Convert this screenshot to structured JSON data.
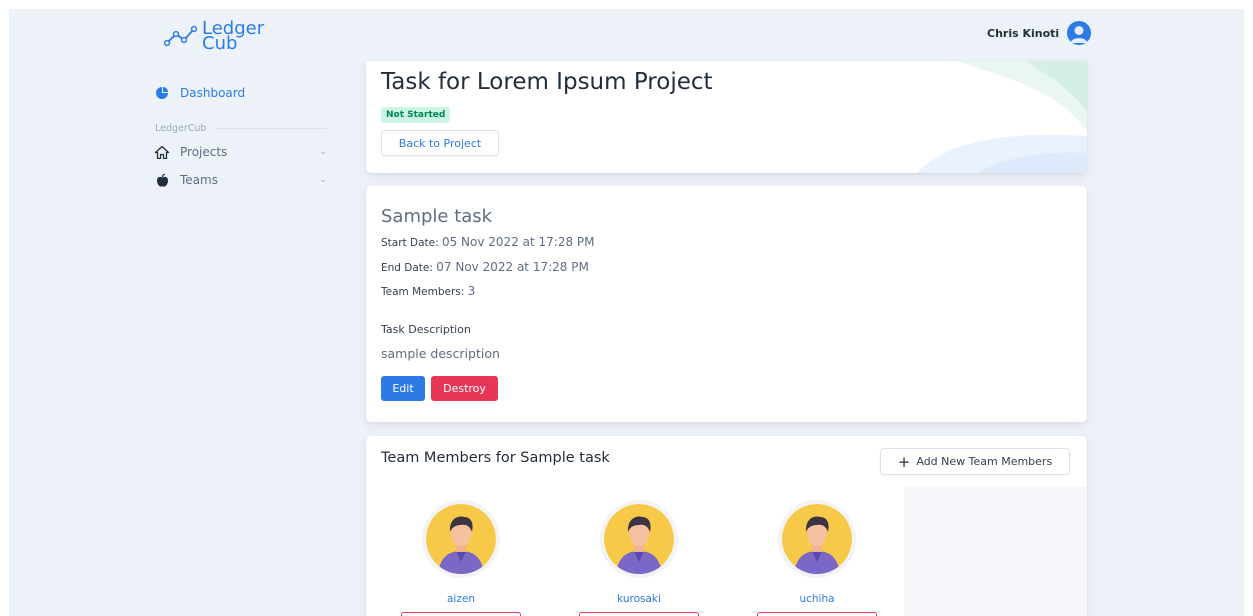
{
  "brand": {
    "line1": "Ledger",
    "line2": "Cub",
    "color": "#2c7be5"
  },
  "header": {
    "user_name": "Chris Kinoti",
    "avatar_icon": "user-avatar-icon"
  },
  "sidebar": {
    "items": [
      {
        "label": "Dashboard",
        "icon": "pie-chart-icon",
        "active": true
      }
    ],
    "group_label": "LedgerCub",
    "group_items": [
      {
        "label": "Projects",
        "icon": "home-icon"
      },
      {
        "label": "Teams",
        "icon": "apple-icon"
      }
    ]
  },
  "project": {
    "title": "Task for Lorem Ipsum Project",
    "status": "Not Started",
    "back_label": "Back to Project"
  },
  "task": {
    "name": "Sample task",
    "start_label": "Start Date:",
    "start_value": "05 Nov 2022 at 17:28 PM",
    "end_label": "End Date:",
    "end_value": "07 Nov 2022 at 17:28 PM",
    "members_label": "Team Members:",
    "members_value": "3",
    "description_heading": "Task Description",
    "description": "sample description",
    "edit_label": "Edit",
    "destroy_label": "Destroy"
  },
  "members": {
    "title": "Team Members for Sample task",
    "add_label": "Add New Team Members",
    "list": [
      {
        "name": "aizen"
      },
      {
        "name": "kurosaki"
      },
      {
        "name": "uchiha"
      }
    ]
  },
  "colors": {
    "primary": "#2c7be5",
    "danger": "#e63757",
    "success_bg": "#ccf6e4",
    "success_text": "#00864e",
    "background": "#edf2f9"
  }
}
